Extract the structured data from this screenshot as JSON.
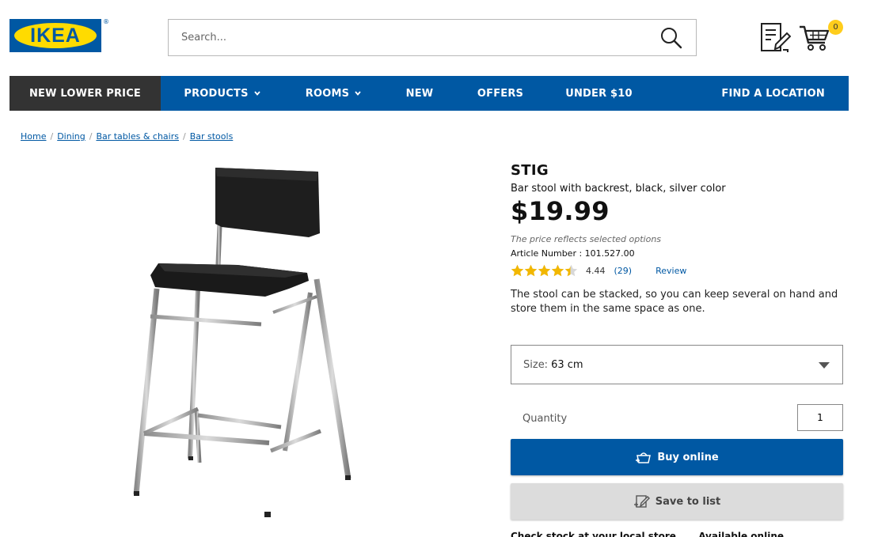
{
  "brand": {
    "logo_text": "IKEA",
    "registered": "®",
    "color": "#0058a3",
    "accent": "#ffdb00"
  },
  "search": {
    "placeholder": "Search..."
  },
  "cart": {
    "count": "0"
  },
  "nav": {
    "items": [
      {
        "label": "NEW LOWER PRICE"
      },
      {
        "label": "PRODUCTS"
      },
      {
        "label": "ROOMS"
      },
      {
        "label": "NEW"
      },
      {
        "label": "OFFERS"
      },
      {
        "label": "UNDER $10"
      },
      {
        "label": "FIND A LOCATION"
      }
    ]
  },
  "breadcrumb": [
    "Home",
    "Dining",
    "Bar tables & chairs",
    "Bar stools"
  ],
  "product": {
    "name": "STIG",
    "description": "Bar stool with backrest, black, silver color",
    "price": "$19.99",
    "price_note": "The price reflects selected options",
    "article": "Article Number : 101.527.00",
    "rating": "4.44",
    "rating_value": 4.44,
    "review_count": "(29)",
    "review_label": "Review",
    "long_description": "The stool can be stacked, so you can keep several on hand and store them in the same space as one."
  },
  "options": {
    "size_label": "Size:",
    "size_value": "63 cm"
  },
  "quantity": {
    "label": "Quantity",
    "value": "1"
  },
  "actions": {
    "buy_label": "Buy online",
    "save_label": "Save to list"
  },
  "links": {
    "stock": "Check stock at your local store",
    "available": "Available online"
  }
}
